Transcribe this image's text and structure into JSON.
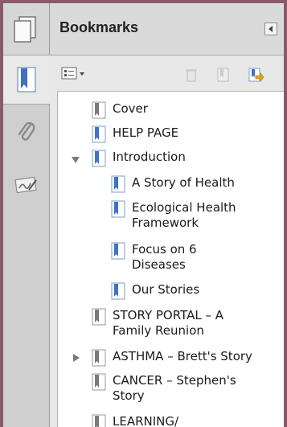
{
  "panel": {
    "title": "Bookmarks"
  },
  "icons": {
    "pages": "pages-icon",
    "bookmark": "bookmark-icon",
    "attachment": "paperclip-icon",
    "signature": "signature-icon",
    "options": "options-menu-icon",
    "delete": "trash-icon",
    "new_bookmark": "new-bookmark-icon",
    "expand_bookmark": "expand-current-bookmark-icon",
    "collapse_panel": "collapse-panel-icon"
  },
  "colors": {
    "accent": "#4a7bc8",
    "bookmark_gray": "#8c8c8c"
  },
  "bookmarks": [
    {
      "label": "Cover",
      "indent": 0,
      "twisty": "none"
    },
    {
      "label": "HELP PAGE",
      "indent": 0,
      "twisty": "none"
    },
    {
      "label": "Introduction",
      "indent": 0,
      "twisty": "expanded"
    },
    {
      "label": "A Story of Health",
      "indent": 1,
      "twisty": "none"
    },
    {
      "label_line1": "Ecological Health",
      "label_line2": "Framework",
      "indent": 1,
      "twisty": "none"
    },
    {
      "label_line1": "Focus on 6",
      "label_line2": "Diseases",
      "indent": 1,
      "twisty": "none"
    },
    {
      "label": "Our Stories",
      "indent": 1,
      "twisty": "none"
    },
    {
      "label_line1": "STORY PORTAL – A",
      "label_line2": "Family Reunion",
      "indent": 0,
      "twisty": "none"
    },
    {
      "label": "ASTHMA – Brett's Story",
      "indent": 0,
      "twisty": "collapsed"
    },
    {
      "label_line1": "CANCER – Stephen's",
      "label_line2": "Story",
      "indent": 0,
      "twisty": "none"
    },
    {
      "label": "LEARNING/",
      "indent": 0,
      "twisty": "none"
    }
  ]
}
